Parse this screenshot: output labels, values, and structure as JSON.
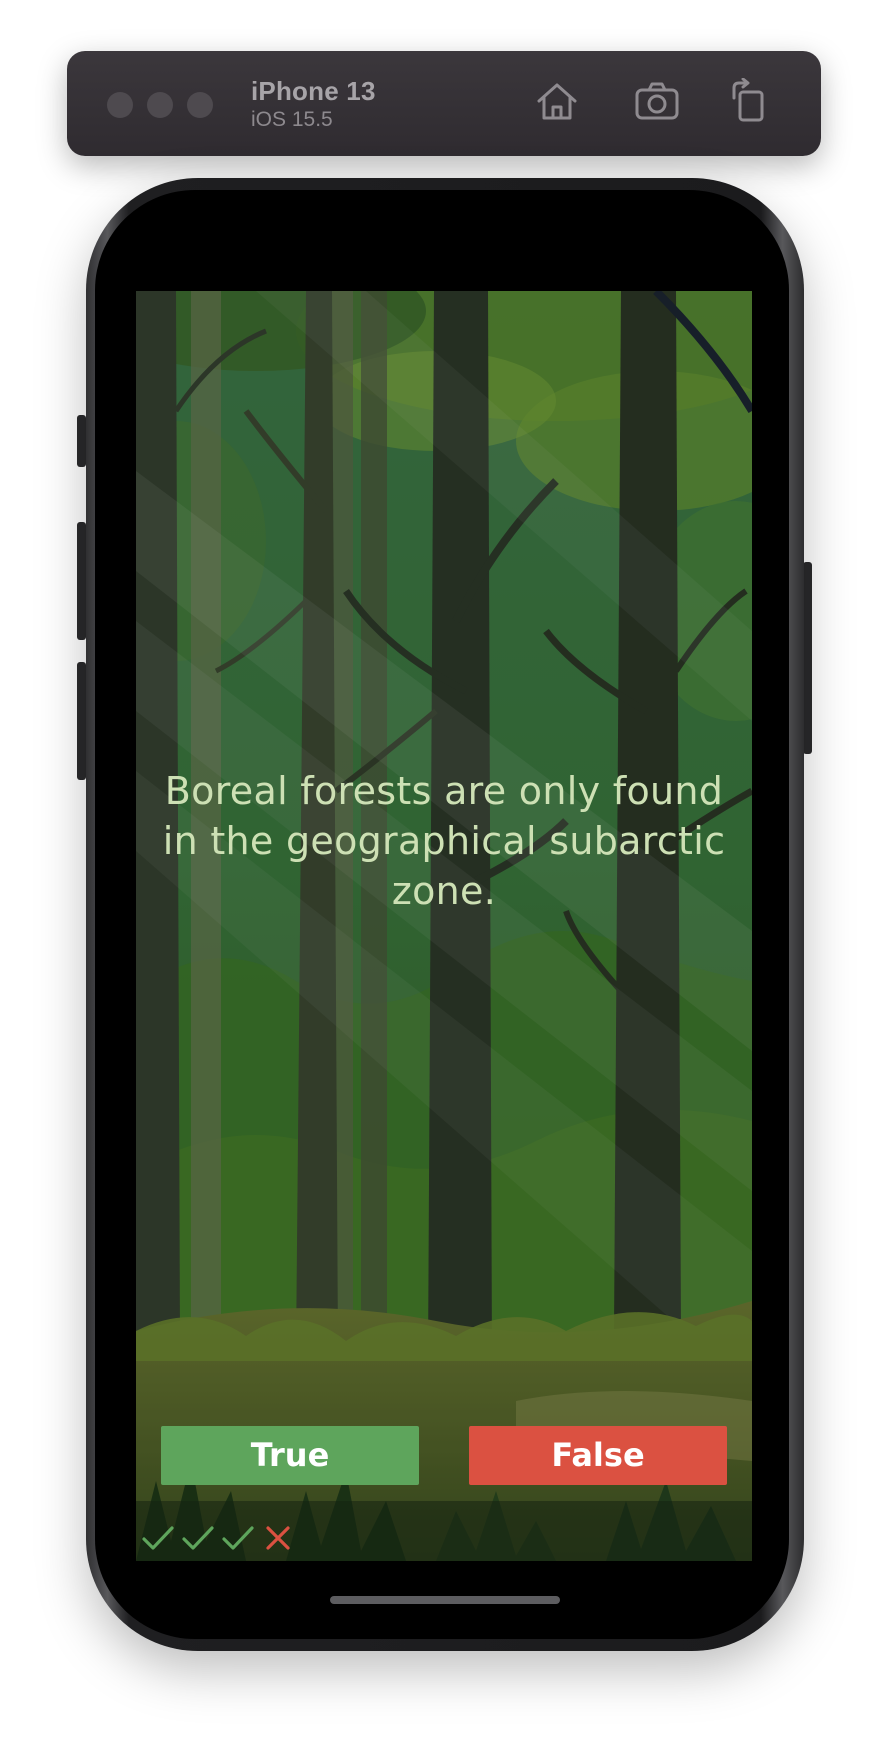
{
  "simulator": {
    "device_name": "iPhone 13",
    "os_version": "iOS 15.5",
    "icons": [
      "home-icon",
      "screenshot-icon",
      "rotate-icon"
    ]
  },
  "quiz": {
    "question": "Boreal forests are only found in the geographical subarctic zone.",
    "true_label": "True",
    "false_label": "False",
    "results": [
      {
        "outcome": "correct",
        "icon": "checkmark-icon",
        "color": "#5ea55c"
      },
      {
        "outcome": "correct",
        "icon": "checkmark-icon",
        "color": "#5ea55c"
      },
      {
        "outcome": "correct",
        "icon": "checkmark-icon",
        "color": "#5ea55c"
      },
      {
        "outcome": "incorrect",
        "icon": "cross-icon",
        "color": "#db5141"
      }
    ]
  },
  "colors": {
    "true_button": "#5ea55c",
    "false_button": "#db5141",
    "question_text": "#cde0b4",
    "toolbar": "#37333a"
  }
}
